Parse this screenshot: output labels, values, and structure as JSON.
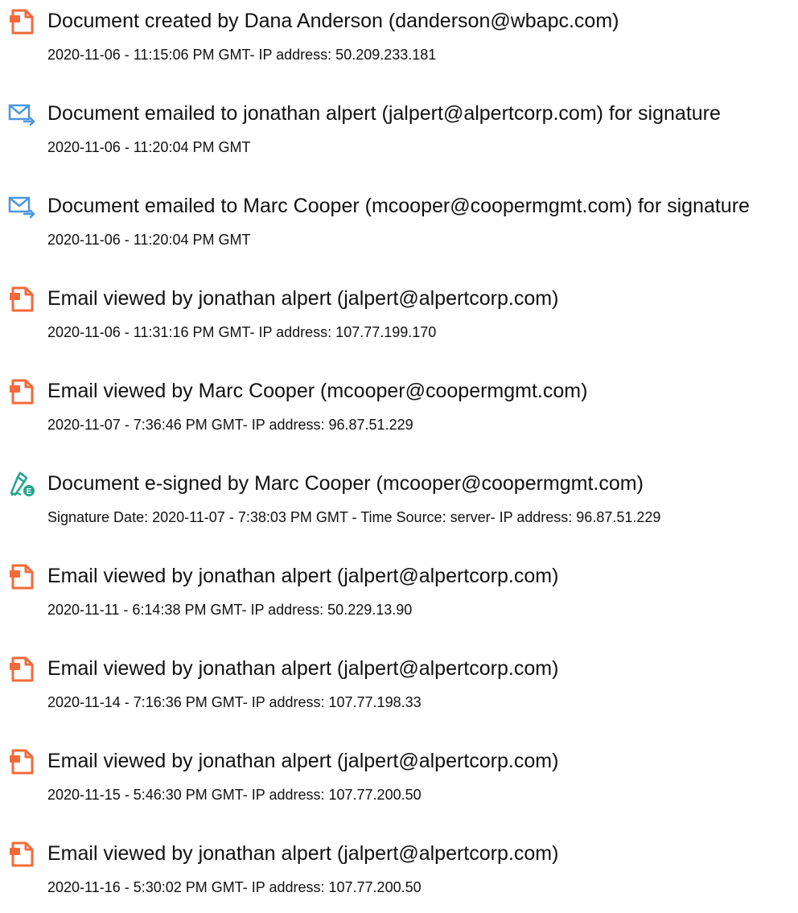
{
  "accent_colors": {
    "document_icon": "#f26a3a",
    "email_icon": "#4a97e0",
    "signature_icon": "#22a68b"
  },
  "events": [
    {
      "icon": "document-icon",
      "title": "Document created by Dana Anderson (danderson@wbapc.com)",
      "detail": "2020-11-06 - 11:15:06 PM GMT- IP address: 50.209.233.181"
    },
    {
      "icon": "email-sent-icon",
      "title": "Document emailed to jonathan alpert (jalpert@alpertcorp.com) for signature",
      "detail": "2020-11-06 - 11:20:04 PM GMT"
    },
    {
      "icon": "email-sent-icon",
      "title": "Document emailed to Marc Cooper (mcooper@coopermgmt.com) for signature",
      "detail": "2020-11-06 - 11:20:04 PM GMT"
    },
    {
      "icon": "document-icon",
      "title": "Email viewed by jonathan alpert (jalpert@alpertcorp.com)",
      "detail": "2020-11-06 - 11:31:16 PM GMT- IP address: 107.77.199.170"
    },
    {
      "icon": "document-icon",
      "title": "Email viewed by Marc Cooper (mcooper@coopermgmt.com)",
      "detail": "2020-11-07 - 7:36:46 PM GMT- IP address: 96.87.51.229"
    },
    {
      "icon": "esign-pen-icon",
      "title": "Document e-signed by Marc Cooper (mcooper@coopermgmt.com)",
      "detail": "Signature Date: 2020-11-07 - 7:38:03 PM GMT - Time Source: server- IP address: 96.87.51.229"
    },
    {
      "icon": "document-icon",
      "title": "Email viewed by jonathan alpert (jalpert@alpertcorp.com)",
      "detail": "2020-11-11 - 6:14:38 PM GMT- IP address: 50.229.13.90"
    },
    {
      "icon": "document-icon",
      "title": "Email viewed by jonathan alpert (jalpert@alpertcorp.com)",
      "detail": "2020-11-14 - 7:16:36 PM GMT- IP address: 107.77.198.33"
    },
    {
      "icon": "document-icon",
      "title": "Email viewed by jonathan alpert (jalpert@alpertcorp.com)",
      "detail": "2020-11-15 - 5:46:30 PM GMT- IP address: 107.77.200.50"
    },
    {
      "icon": "document-icon",
      "title": "Email viewed by jonathan alpert (jalpert@alpertcorp.com)",
      "detail": "2020-11-16 - 5:30:02 PM GMT- IP address: 107.77.200.50"
    }
  ]
}
